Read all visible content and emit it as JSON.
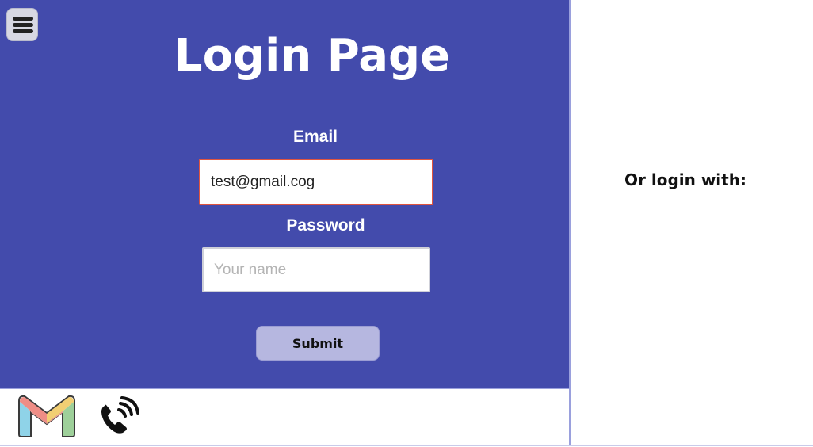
{
  "page": {
    "title": "Login Page"
  },
  "menu": {
    "icon": "hamburger-menu-icon"
  },
  "form": {
    "email_label": "Email",
    "email_value": "test@gmail.cog",
    "password_label": "Password",
    "password_placeholder": "Your name",
    "submit_label": "Submit"
  },
  "alt_login": {
    "heading": "Or login with:"
  },
  "footer_icons": [
    {
      "name": "gmail-icon"
    },
    {
      "name": "phone-icon"
    }
  ],
  "colors": {
    "panel": "#434bac",
    "email_border_error": "#e0553f",
    "submit_bg": "#b6b7e0"
  }
}
